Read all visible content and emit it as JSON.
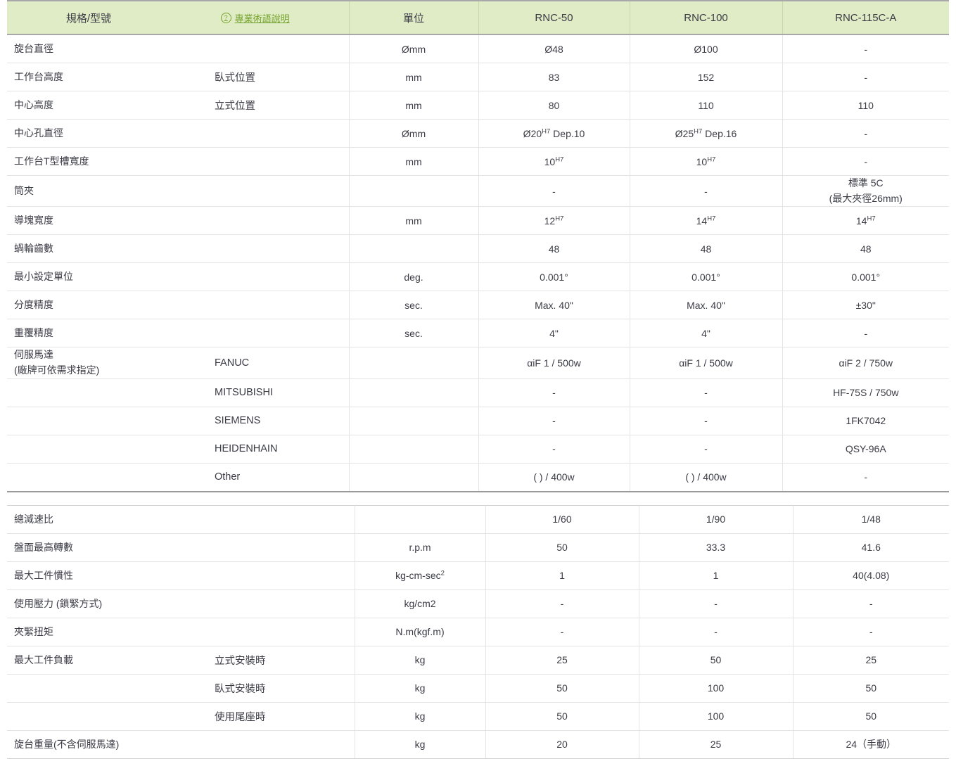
{
  "header": {
    "spec_label": "規格/型號",
    "term_link": "專業術語說明",
    "term_icon": "question-circle-icon",
    "unit_label": "單位",
    "models": [
      "RNC-50",
      "RNC-100",
      "RNC-115C-A"
    ],
    "bg_color": "#dfecc5",
    "link_color": "#76a32e"
  },
  "table1": {
    "rows": [
      {
        "name": "旋台直徑",
        "sub": "",
        "unit": "Ømm",
        "values": [
          "Ø48",
          "Ø100",
          "-"
        ]
      },
      {
        "name": "工作台高度",
        "sub": "臥式位置",
        "unit": "mm",
        "values": [
          "83",
          "152",
          "-"
        ]
      },
      {
        "name": "中心高度",
        "sub": "立式位置",
        "unit": "mm",
        "values": [
          "80",
          "110",
          "110"
        ]
      },
      {
        "name": "中心孔直徑",
        "sub": "",
        "unit": "Ømm",
        "values": [
          "Ø20^H7 Dep.10",
          "Ø25^H7 Dep.16",
          "-"
        ]
      },
      {
        "name": "工作台T型槽寬度",
        "sub": "",
        "unit": "mm",
        "values": [
          "10^H7",
          "10^H7",
          "-"
        ]
      },
      {
        "name": "筒夾",
        "sub": "",
        "unit": "",
        "values": [
          "-",
          "-",
          "標準 5C\n(最大夾徑26mm)"
        ]
      },
      {
        "name": "導塊寬度",
        "sub": "",
        "unit": "mm",
        "values": [
          "12^H7",
          "14^H7",
          "14^H7"
        ]
      },
      {
        "name": "蝸輪齒數",
        "sub": "",
        "unit": "",
        "values": [
          "48",
          "48",
          "48"
        ]
      },
      {
        "name": "最小設定單位",
        "sub": "",
        "unit": "deg.",
        "values": [
          "0.001°",
          "0.001°",
          "0.001°"
        ]
      },
      {
        "name": "分度精度",
        "sub": "",
        "unit": "sec.",
        "values": [
          "Max. 40\"",
          "Max. 40\"",
          "±30\""
        ]
      },
      {
        "name": "重覆精度",
        "sub": "",
        "unit": "sec.",
        "values": [
          "4\"",
          "4\"",
          "-"
        ]
      },
      {
        "name": "伺服馬達\n(廠牌可依需求指定)",
        "sub": "FANUC",
        "unit": "",
        "values": [
          "αiF 1 / 500w",
          "αiF 1 / 500w",
          "αiF 2 / 750w"
        ]
      },
      {
        "name": "",
        "sub": "MITSUBISHI",
        "unit": "",
        "values": [
          "-",
          "-",
          "HF-75S / 750w"
        ]
      },
      {
        "name": "",
        "sub": "SIEMENS",
        "unit": "",
        "values": [
          "-",
          "-",
          "1FK7042"
        ]
      },
      {
        "name": "",
        "sub": "HEIDENHAIN",
        "unit": "",
        "values": [
          "-",
          "-",
          "QSY-96A"
        ]
      },
      {
        "name": "",
        "sub": "Other",
        "unit": "",
        "values": [
          "( ) / 400w",
          "( ) / 400w",
          "-"
        ]
      }
    ]
  },
  "table2": {
    "rows": [
      {
        "name": "總減速比",
        "sub": "",
        "unit": "",
        "values": [
          "1/60",
          "1/90",
          "1/48"
        ]
      },
      {
        "name": "盤面最高轉數",
        "sub": "",
        "unit": "r.p.m",
        "values": [
          "50",
          "33.3",
          "41.6"
        ]
      },
      {
        "name": "最大工件慣性",
        "sub": "",
        "unit": "kg-cm-sec^2",
        "values": [
          "1",
          "1",
          "40(4.08)"
        ]
      },
      {
        "name": "使用壓力 (鎖緊方式)",
        "sub": "",
        "unit": "kg/cm2",
        "values": [
          "-",
          "-",
          "-"
        ]
      },
      {
        "name": "夾緊扭矩",
        "sub": "",
        "unit": "N.m(kgf.m)",
        "values": [
          "-",
          "-",
          "-"
        ]
      },
      {
        "name": "最大工件負載",
        "sub": "立式安裝時",
        "unit": "kg",
        "values": [
          "25",
          "50",
          "25"
        ]
      },
      {
        "name": "",
        "sub": "臥式安裝時",
        "unit": "kg",
        "values": [
          "50",
          "100",
          "50"
        ]
      },
      {
        "name": "",
        "sub": "使用尾座時",
        "unit": "kg",
        "values": [
          "50",
          "100",
          "50"
        ]
      },
      {
        "name": "旋台重量(不含伺服馬達)",
        "sub": "",
        "unit": "kg",
        "values": [
          "20",
          "25",
          "24（手動）"
        ]
      }
    ]
  }
}
